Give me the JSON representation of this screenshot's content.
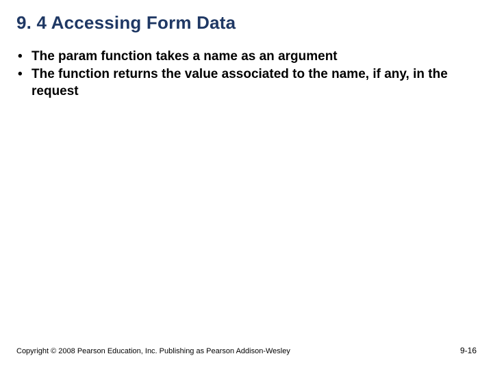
{
  "title": "9. 4 Accessing Form Data",
  "bullets": [
    "The param function takes a name as an argument",
    "The function returns the value associated to the name, if any, in the request"
  ],
  "footer": {
    "copyright": "Copyright © 2008 Pearson Education, Inc. Publishing as Pearson Addison-Wesley",
    "page": "9-16"
  }
}
